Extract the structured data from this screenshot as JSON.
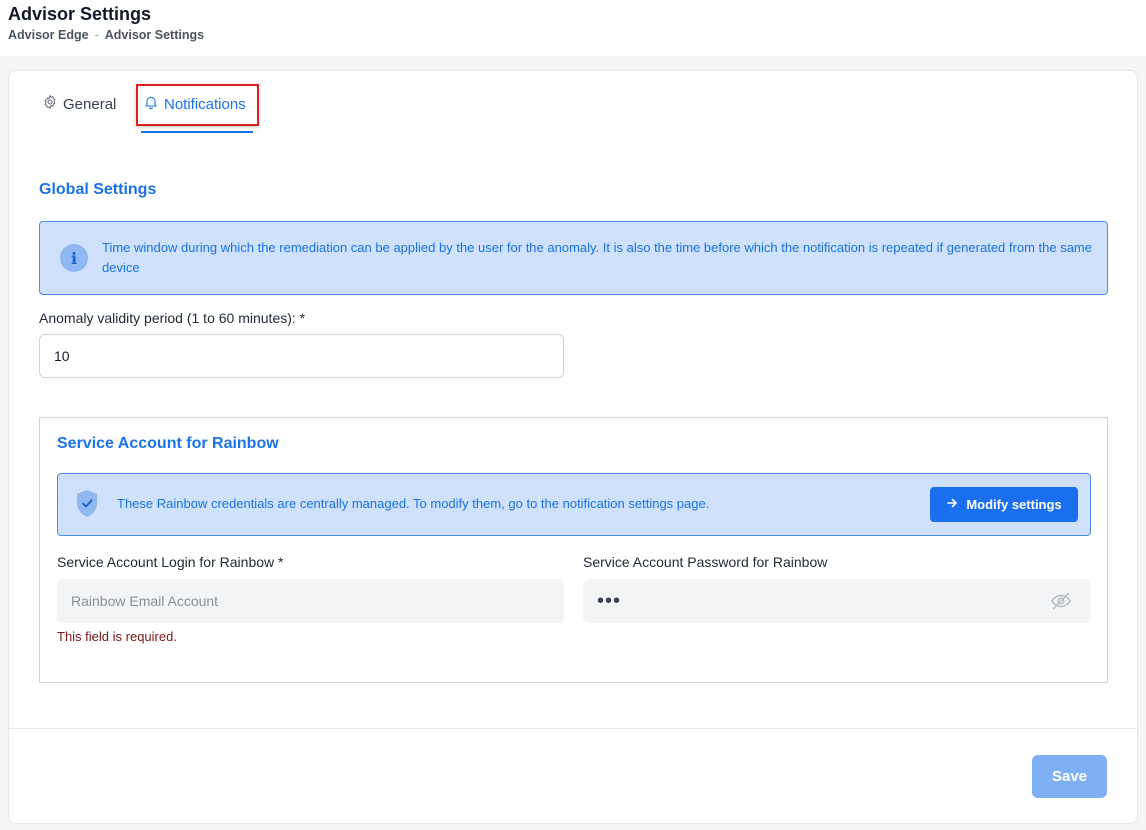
{
  "header": {
    "title": "Advisor Settings",
    "breadcrumb": [
      "Advisor Edge",
      "Advisor Settings"
    ],
    "breadcrumb_separator": "-"
  },
  "tabs": [
    {
      "label": "General",
      "icon": "gear-icon",
      "active": false
    },
    {
      "label": "Notifications",
      "icon": "bell-icon",
      "active": true
    }
  ],
  "global_settings": {
    "title": "Global Settings",
    "info_text": "Time window during which the remediation can be applied by the user for the anomaly. It is also the time before which the notification is repeated if generated from the same device",
    "validity_label": "Anomaly validity period (1 to 60 minutes): *",
    "validity_value": "10"
  },
  "service_account": {
    "title": "Service Account for Rainbow",
    "managed_text": "These Rainbow credentials are centrally managed. To modify them, go to the notification settings page.",
    "modify_button": "Modify settings",
    "login_label": "Service Account Login for Rainbow *",
    "login_placeholder": "Rainbow Email Account",
    "login_error": "This field is required.",
    "password_label": "Service Account Password for Rainbow",
    "password_value": "•••"
  },
  "footer": {
    "save_label": "Save"
  },
  "colors": {
    "accent": "#1a73e8",
    "info_background": "#cfe1fc",
    "error": "#7a1616",
    "save_disabled": "#7fb0f5"
  }
}
